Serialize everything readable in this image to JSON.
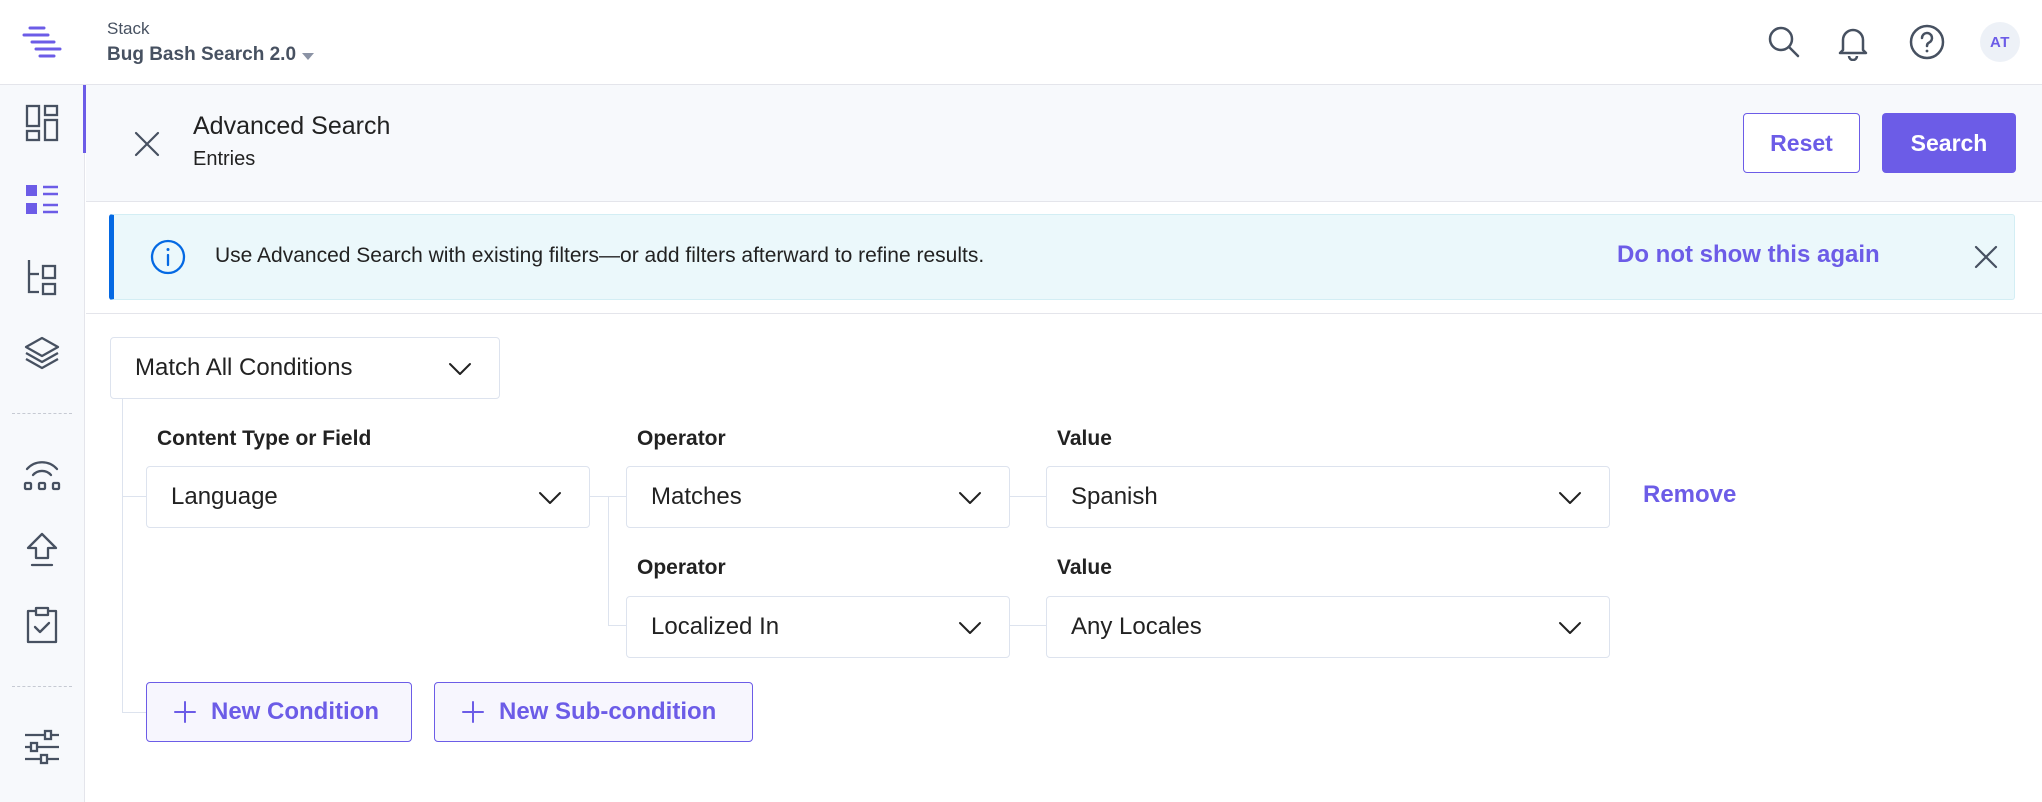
{
  "header": {
    "stack_label": "Stack",
    "stack_name": "Bug Bash Search 2.0",
    "avatar_initials": "AT"
  },
  "sidebar": {
    "items": [
      {
        "icon": "dashboard-icon"
      },
      {
        "icon": "entries-icon",
        "active": true
      },
      {
        "icon": "content-models-icon"
      },
      {
        "icon": "assets-icon"
      },
      {
        "icon": "releases-icon"
      },
      {
        "icon": "deploy-icon"
      },
      {
        "icon": "tasks-icon"
      },
      {
        "icon": "settings-icon"
      }
    ]
  },
  "panel": {
    "title": "Advanced Search",
    "subtitle": "Entries",
    "reset_label": "Reset",
    "search_label": "Search"
  },
  "banner": {
    "text": "Use Advanced Search with existing filters—or add filters afterward to refine results.",
    "dismiss_link": "Do not show this again"
  },
  "query": {
    "match_mode": "Match All Conditions",
    "field_label": "Content Type or Field",
    "field_value": "Language",
    "operator_label": "Operator",
    "operator_value": "Matches",
    "value_label": "Value",
    "value_value": "Spanish",
    "remove_label": "Remove",
    "sub_operator_label": "Operator",
    "sub_operator_value": "Localized In",
    "sub_value_label": "Value",
    "sub_value_value": "Any Locales",
    "new_condition_label": "New Condition",
    "new_subcondition_label": "New Sub-condition"
  },
  "colors": {
    "accent": "#6c5ce7",
    "info_border": "#0469e3",
    "info_bg": "#ebf8fb",
    "icon_gray": "#475161"
  }
}
